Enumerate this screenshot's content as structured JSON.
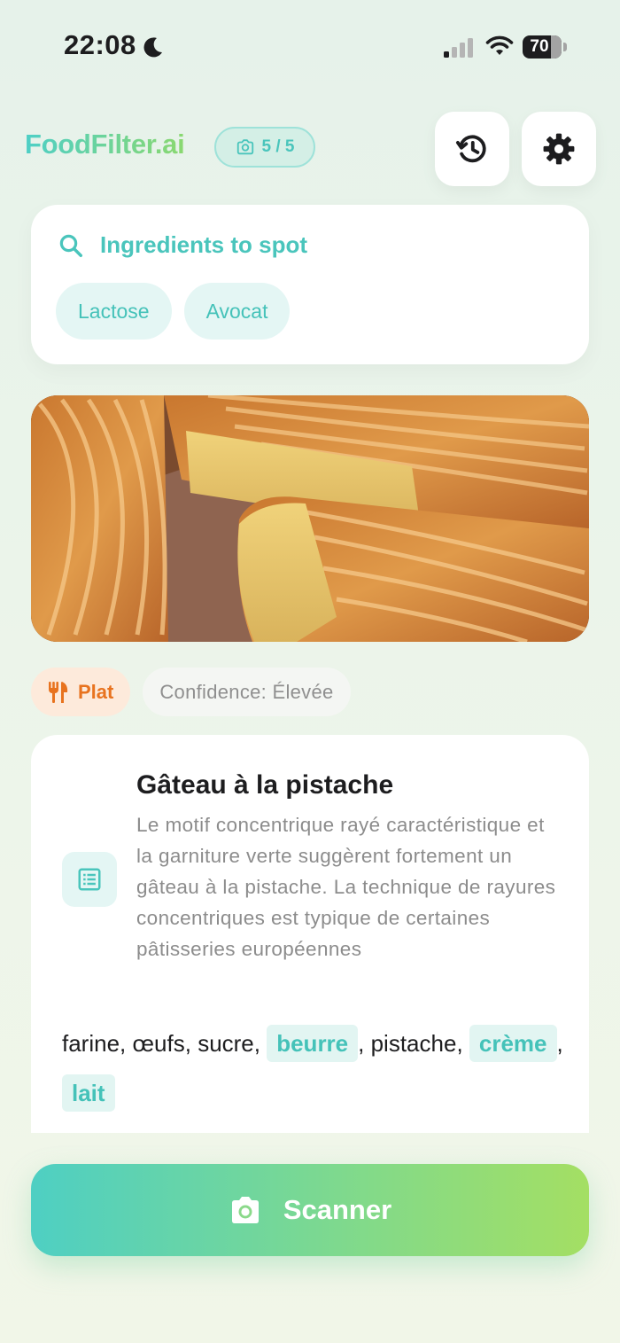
{
  "status_bar": {
    "time": "22:08",
    "battery": "70"
  },
  "header": {
    "brand": "FoodFilter.ai",
    "scan_count": "5 / 5",
    "icons": {
      "history": "history-icon",
      "settings": "gear-icon"
    }
  },
  "ingredients_to_spot": {
    "title": "Ingredients to spot",
    "items": [
      "Lactose",
      "Avocat"
    ]
  },
  "result": {
    "category": "Plat",
    "confidence": "Confidence: Élevée",
    "dish_name": "Gâteau à la pistache",
    "description": "Le motif concentrique rayé caractéristique et la garniture verte suggèrent fortement un gâteau à la pistache. La technique de rayures concentriques est typique de certaines pâtisseries européennes",
    "ingredients": [
      {
        "text": "farine",
        "flagged": false
      },
      {
        "text": "œufs",
        "flagged": false
      },
      {
        "text": "sucre",
        "flagged": false
      },
      {
        "text": "beurre",
        "flagged": true
      },
      {
        "text": "pistache",
        "flagged": false
      },
      {
        "text": "crème",
        "flagged": true
      },
      {
        "text": "lait",
        "flagged": true
      }
    ]
  },
  "scan_button": {
    "label": "Scanner"
  },
  "colors": {
    "accent": "#4ac5bc",
    "brand_gradient": [
      "#4ecfc6",
      "#8ad870"
    ],
    "category": "#e8731f"
  }
}
